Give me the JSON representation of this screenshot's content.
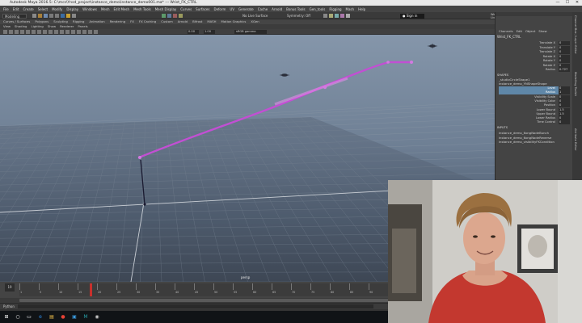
{
  "window": {
    "title": "Autodesk Maya 2016.5: C:\\mcs\\Ynsd_project\\instance_demo\\instance_demo001.ma*   ---   Wrist_FK_CTRL",
    "controls": [
      "—",
      "☐",
      "✕"
    ]
  },
  "menubar": {
    "items": [
      "File",
      "Edit",
      "Create",
      "Select",
      "Modify",
      "Display",
      "Windows",
      "Mesh",
      "Edit Mesh",
      "Mesh Tools",
      "Mesh Display",
      "Curves",
      "Surfaces",
      "Deform",
      "UV",
      "Generate",
      "Cache",
      "Arnold",
      "Bonus Tools",
      "Gen_tools",
      "Rigging",
      "Mash",
      "Help"
    ]
  },
  "statusline": {
    "mode": "Modeling",
    "live_surface": "No Live Surface",
    "symmetry": "Symmetry: Off",
    "sign_in": "Sign in",
    "workspace_label": "Workspace:",
    "workspace_value": "Maya Classic",
    "project_label": "Live Project:",
    "project_value": "Ynsd_project"
  },
  "shelf": {
    "tabs": [
      "Curves / Surfaces",
      "Polygons",
      "Sculpting",
      "Rigging",
      "Animation",
      "Rendering",
      "FX",
      "FX Caching",
      "Custom",
      "Arnold",
      "Bifrost",
      "MASH",
      "Motion Graphics",
      "XGen"
    ]
  },
  "panel_menu": {
    "items": [
      "View",
      "Shading",
      "Lighting",
      "Show",
      "Renderer",
      "Panels"
    ]
  },
  "viewport_toolbar": {
    "value_a": "0.00",
    "value_b": "1.00",
    "color_space": "sRGB gamma"
  },
  "viewport": {
    "camera_label": "persp"
  },
  "channel_box": {
    "tabs": [
      "Channels",
      "Edit",
      "Object",
      "Show"
    ],
    "object_name": "Wrist_FK_CTRL",
    "attributes": [
      {
        "name": "Translate X",
        "value": "0"
      },
      {
        "name": "Translate Y",
        "value": "0"
      },
      {
        "name": "Translate Z",
        "value": "0"
      },
      {
        "name": "Rotate X",
        "value": "0"
      },
      {
        "name": "Rotate Y",
        "value": "0"
      },
      {
        "name": "Rotate Z",
        "value": "0"
      },
      {
        "name": "Radius",
        "value": "0.727"
      }
    ],
    "shapes_header": "SHAPES",
    "shapes": [
      {
        "name": "_studioCircleShape1"
      },
      {
        "name": "instance_demo_YNShapeShape"
      }
    ],
    "shape_attrs": [
      {
        "name": "Level",
        "value": "0",
        "selected": true
      },
      {
        "name": "Radius",
        "value": "1",
        "selected": true
      },
      {
        "name": "Visibility Scale",
        "value": "0",
        "selected": false
      },
      {
        "name": "Visibility Color",
        "value": "0",
        "selected": false
      },
      {
        "name": "Position",
        "value": "0",
        "selected": false
      },
      {
        "name": "Lower Bound",
        "value": "1.5",
        "selected": false
      },
      {
        "name": "Upper Bound",
        "value": "1.5",
        "selected": false
      },
      {
        "name": "Lower Radius",
        "value": "0",
        "selected": false
      },
      {
        "name": "Time Control",
        "value": "0",
        "selected": false
      }
    ],
    "inputs_header": "INPUTS",
    "inputs": [
      {
        "name": "instance_demo_6ongNodeBunch"
      },
      {
        "name": "instance_demo_6ongNodeReverse"
      },
      {
        "name": "instance_demo_visibilityFKCondition"
      }
    ]
  },
  "side_tabs": [
    "Channel Box / Layer Editor",
    "Modelling Toolkit",
    "Attribute Editor"
  ],
  "timeline": {
    "current": "19",
    "ticks": [
      "1",
      "5",
      "10",
      "15",
      "20",
      "25",
      "30",
      "35",
      "40",
      "45",
      "50",
      "55",
      "60",
      "65",
      "70",
      "75",
      "80",
      "85",
      "90",
      "95",
      "100",
      "105",
      "110",
      "115",
      "120"
    ]
  },
  "command_line": {
    "label": "Python"
  },
  "taskbar": {
    "icons": [
      {
        "name": "windows-start",
        "glyph": "⊞",
        "color": "#ffffff"
      },
      {
        "name": "search",
        "glyph": "○",
        "color": "#ffffff"
      },
      {
        "name": "task-view",
        "glyph": "▭",
        "color": "#ffffff"
      },
      {
        "name": "edge",
        "glyph": "e",
        "color": "#2d8ae6"
      },
      {
        "name": "explorer",
        "glyph": "▤",
        "color": "#f2c14b"
      },
      {
        "name": "chrome",
        "glyph": "●",
        "color": "#e94235"
      },
      {
        "name": "store",
        "glyph": "▣",
        "color": "#3b9be0"
      },
      {
        "name": "maya",
        "glyph": "M",
        "color": "#28a0a8"
      },
      {
        "name": "obs",
        "glyph": "◉",
        "color": "#cccccc"
      }
    ]
  },
  "colors": {
    "curve": "#c24fd3",
    "selected_attr": "#5f87a8",
    "maya_teal": "#28a0a8"
  }
}
